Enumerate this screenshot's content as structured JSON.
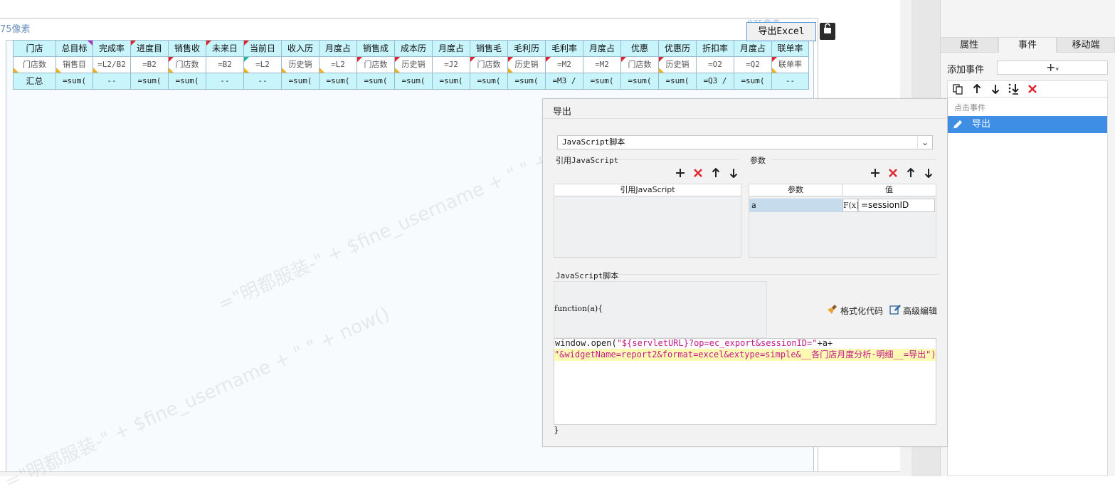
{
  "canvas": {
    "width_label": "75像素",
    "button_dim_label": "975像素",
    "export_button_label": "导出Excel"
  },
  "sheet": {
    "headers": [
      "门店",
      "总目标",
      "完成率",
      "进度目",
      "销售收",
      "未来日",
      "当前日",
      "收入历",
      "月度占",
      "销售成",
      "成本历",
      "月度占",
      "销售毛",
      "毛利历",
      "毛利率",
      "月度占",
      "优惠",
      "优惠历",
      "折扣率",
      "月度占",
      "联单率"
    ],
    "detail": [
      "门店数",
      "销售目",
      "=L2/B2",
      "=B2",
      "门店数",
      "=B2",
      "=L2",
      "历史销",
      "=L2",
      "门店数",
      "历史销",
      "=J2",
      "门店数",
      "历史销",
      "=M2",
      "=M2",
      "门店数",
      "历史销",
      "=O2",
      "=Q2",
      "联单率"
    ],
    "total": [
      "汇总",
      "=sum(",
      "--",
      "=sum(",
      "=sum(",
      "--",
      "--",
      "=sum(",
      "=sum(",
      "=sum(",
      "=sum(",
      "=sum(",
      "=sum(",
      "=sum(",
      "=M3 /",
      "=sum(",
      "=sum(",
      "=sum(",
      "=Q3 /",
      "=sum(",
      "--"
    ]
  },
  "watermark": {
    "text1": "=\"明都服装-\" + $fine_username + \" \" + now()",
    "text2": "=\"明都服装-\" + $fine_username + \" \" + now()"
  },
  "right_panel": {
    "tabs": [
      "属性",
      "事件",
      "移动端"
    ],
    "active_tab": "事件",
    "add_event_label": "添加事件",
    "add_event_symbol": "+",
    "group_label": "点击事件",
    "event_item": "导出"
  },
  "dialog": {
    "title": "导出",
    "type_value": "JavaScript脚本",
    "ref_js_label": "引用JavaScript",
    "ref_js_col": "引用JavaScript",
    "params_label": "参数",
    "param_col_name": "参数",
    "param_col_value": "值",
    "param_name": "a",
    "param_fx": "F(x)",
    "param_value": "=sessionID",
    "js_script_label": "JavaScript脚本",
    "func_line": "function(a){",
    "format_code": "格式化代码",
    "advanced_edit": "高级编辑",
    "code_line1_plain": "window.open(",
    "code_line1_str": "\"${servletURL}?op=ec_export&sessionID=\"",
    "code_line1_tail": "+a+",
    "code_line2": "\"&widgetName=report2&format=excel&extype=simple&__各门店月度分析-明细__=导出\")",
    "close_brace": "}"
  },
  "colors": {
    "accent": "#3e8ee6",
    "header_cell": "#c8f4fb",
    "delete_red": "#e0232b",
    "code_highlight": "#fdfbb3"
  }
}
